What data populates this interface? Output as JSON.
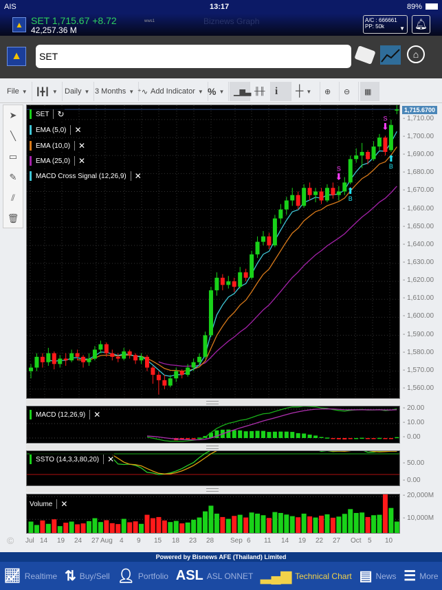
{
  "status": {
    "carrier": "AIS",
    "time": "13:17",
    "battery": "89%"
  },
  "header": {
    "ticker": "SET 1,715.67 +8.72",
    "volume": "42,257.36 M",
    "server": "wws1",
    "title": "Biznews Graph",
    "account": "A/C : 666661",
    "pp": "PP: 50k"
  },
  "search": {
    "value": "SET"
  },
  "toolbar": {
    "file": "File",
    "period": "Daily",
    "range": "3 Months",
    "add_indicator": "Add Indicator",
    "percent": "%"
  },
  "legend": {
    "symbol": "SET",
    "ema5": "EMA (5,0)",
    "ema10": "EMA (10,0)",
    "ema25": "EMA (25,0)",
    "macd_cross": "MACD Cross Signal (12,26,9)",
    "macd": "MACD (12,26,9)",
    "ssto": "SSTO (14,3,3,80,20)",
    "volume": "Volume"
  },
  "colors": {
    "up": "#19d219",
    "down": "#ff1a1a",
    "ema5": "#3fc6d6",
    "ema10": "#d97a1a",
    "ema25": "#a321a8",
    "signal": "#ff3cff",
    "buy": "#22e0f0"
  },
  "price_label": "1,715.6700",
  "price_axis": [
    "1,710.00",
    "1,700.00",
    "1,690.00",
    "1,680.00",
    "1,670.00",
    "1,660.00",
    "1,650.00",
    "1,640.00",
    "1,630.00",
    "1,620.00",
    "1,610.00",
    "1,600.00",
    "1,590.00",
    "1,580.00",
    "1,570.00",
    "1,560.00"
  ],
  "macd_axis": [
    "20.00",
    "10.00",
    "0.00"
  ],
  "ssto_axis": [
    "50.00",
    "0.00"
  ],
  "volume_axis": [
    "20,000M",
    "10,000M"
  ],
  "x_labels": [
    "Jul",
    "14",
    "19",
    "24",
    "27",
    "Aug",
    "4",
    "9",
    "15",
    "18",
    "23",
    "28",
    "Sep",
    "6",
    "11",
    "14",
    "19",
    "22",
    "27",
    "Oct",
    "5",
    "10"
  ],
  "signals": {
    "sell": "S",
    "buy": "B"
  },
  "chart_data": {
    "type": "candlestick",
    "ylim": [
      1555,
      1718
    ],
    "candles": [
      [
        1570,
        1574,
        1566,
        1572
      ],
      [
        1572,
        1580,
        1570,
        1578
      ],
      [
        1578,
        1580,
        1572,
        1575
      ],
      [
        1575,
        1583,
        1573,
        1580
      ],
      [
        1580,
        1581,
        1571,
        1574
      ],
      [
        1574,
        1579,
        1572,
        1577
      ],
      [
        1577,
        1580,
        1573,
        1576
      ],
      [
        1576,
        1582,
        1575,
        1580
      ],
      [
        1580,
        1582,
        1576,
        1578
      ],
      [
        1578,
        1579,
        1572,
        1575
      ],
      [
        1575,
        1580,
        1573,
        1577
      ],
      [
        1577,
        1584,
        1576,
        1582
      ],
      [
        1582,
        1587,
        1580,
        1585
      ],
      [
        1585,
        1586,
        1578,
        1580
      ],
      [
        1580,
        1582,
        1576,
        1578
      ],
      [
        1578,
        1580,
        1575,
        1577
      ],
      [
        1577,
        1583,
        1576,
        1581
      ],
      [
        1581,
        1582,
        1577,
        1579
      ],
      [
        1579,
        1580,
        1574,
        1576
      ],
      [
        1576,
        1580,
        1574,
        1578
      ],
      [
        1578,
        1579,
        1570,
        1572
      ],
      [
        1572,
        1573,
        1563,
        1568
      ],
      [
        1568,
        1570,
        1557,
        1565
      ],
      [
        1565,
        1568,
        1560,
        1562
      ],
      [
        1562,
        1568,
        1561,
        1566
      ],
      [
        1566,
        1572,
        1564,
        1570
      ],
      [
        1570,
        1571,
        1566,
        1568
      ],
      [
        1568,
        1574,
        1567,
        1572
      ],
      [
        1572,
        1577,
        1570,
        1575
      ],
      [
        1575,
        1580,
        1573,
        1578
      ],
      [
        1578,
        1592,
        1577,
        1590
      ],
      [
        1590,
        1617,
        1589,
        1615
      ],
      [
        1615,
        1625,
        1612,
        1622
      ],
      [
        1622,
        1624,
        1615,
        1618
      ],
      [
        1618,
        1623,
        1616,
        1620
      ],
      [
        1620,
        1622,
        1614,
        1617
      ],
      [
        1617,
        1628,
        1616,
        1625
      ],
      [
        1625,
        1627,
        1620,
        1622
      ],
      [
        1622,
        1637,
        1621,
        1635
      ],
      [
        1635,
        1645,
        1633,
        1642
      ],
      [
        1642,
        1648,
        1640,
        1645
      ],
      [
        1645,
        1647,
        1638,
        1640
      ],
      [
        1640,
        1657,
        1639,
        1655
      ],
      [
        1655,
        1663,
        1652,
        1660
      ],
      [
        1660,
        1667,
        1657,
        1665
      ],
      [
        1665,
        1672,
        1662,
        1668
      ],
      [
        1668,
        1670,
        1660,
        1662
      ],
      [
        1662,
        1674,
        1661,
        1672
      ],
      [
        1672,
        1675,
        1665,
        1668
      ],
      [
        1668,
        1672,
        1664,
        1670
      ],
      [
        1670,
        1672,
        1663,
        1665
      ],
      [
        1665,
        1674,
        1664,
        1672
      ],
      [
        1672,
        1675,
        1666,
        1668
      ],
      [
        1668,
        1673,
        1665,
        1670
      ],
      [
        1670,
        1678,
        1668,
        1675
      ],
      [
        1675,
        1690,
        1674,
        1688
      ],
      [
        1688,
        1694,
        1686,
        1690
      ],
      [
        1690,
        1697,
        1683,
        1692
      ],
      [
        1692,
        1693,
        1685,
        1688
      ],
      [
        1688,
        1698,
        1687,
        1695
      ],
      [
        1695,
        1702,
        1693,
        1700
      ],
      [
        1700,
        1701,
        1690,
        1692
      ],
      [
        1693,
        1710,
        1692,
        1707
      ],
      [
        1715,
        1718,
        1713,
        1715.67
      ]
    ],
    "volume_m": [
      9000,
      7500,
      9500,
      8000,
      10000,
      7000,
      8500,
      9000,
      7800,
      8200,
      9200,
      10500,
      8800,
      9600,
      8300,
      7900,
      10200,
      8700,
      9100,
      8000,
      12000,
      10500,
      11000,
      9500,
      8800,
      9300,
      8200,
      8600,
      9800,
      10800,
      13500,
      16000,
      12500,
      11000,
      10200,
      11500,
      12000,
      10800,
      13000,
      12500,
      11800,
      10600,
      13200,
      12800,
      12100,
      11400,
      10900,
      12500,
      11300,
      10800,
      11600,
      12200,
      10700,
      11200,
      12400,
      14500,
      12800,
      13000,
      11000,
      11800,
      12000,
      22500,
      15000,
      9000
    ]
  },
  "footer": {
    "powered": "Powered by Bisnews AFE (Thailand) Limited",
    "nav": [
      "Realtime",
      "Buy/Sell",
      "Portfolio",
      "ASL ONNET",
      "Technical Chart",
      "News",
      "More"
    ],
    "asl": "ASL"
  }
}
